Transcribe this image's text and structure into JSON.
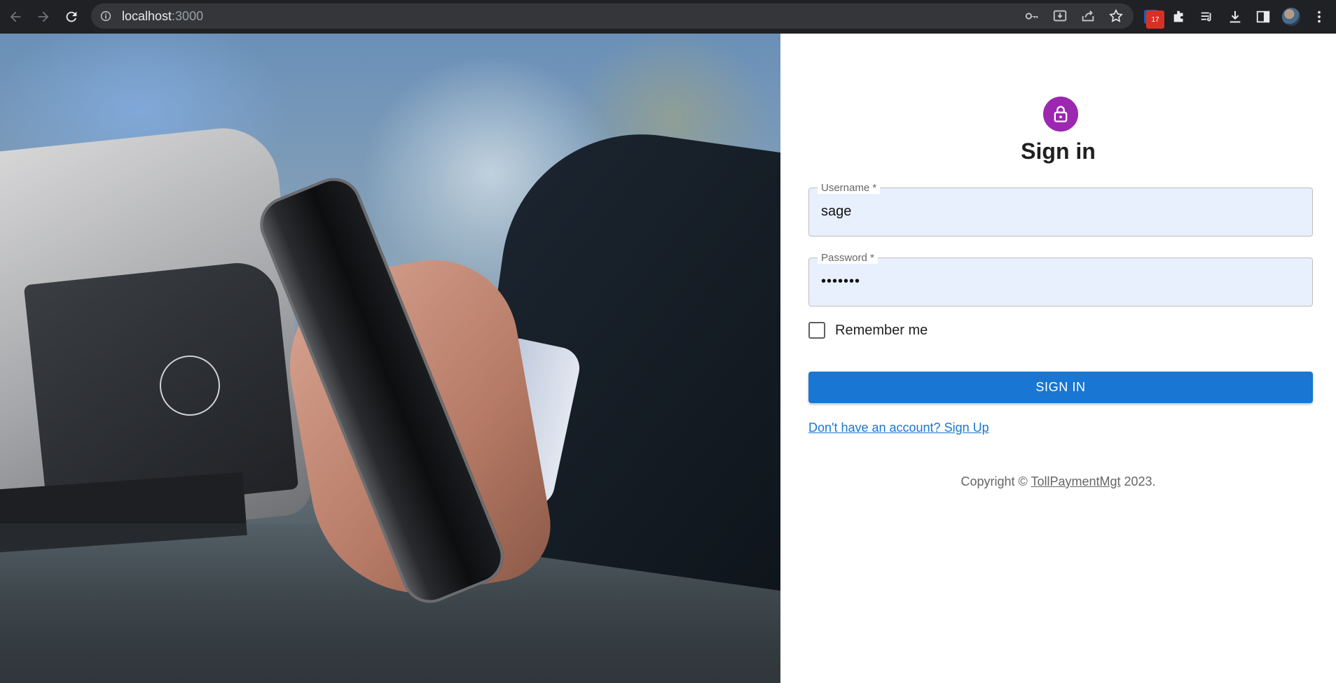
{
  "browser": {
    "url_host": "localhost",
    "url_port": ":3000",
    "extension_badge_count": "17",
    "linkedin_icon_text": "in"
  },
  "signin": {
    "title": "Sign in",
    "username_label": "Username *",
    "username_value": "sage",
    "password_label": "Password *",
    "password_value": "•••••••",
    "remember_label": "Remember me",
    "remember_checked": false,
    "button_label": "SIGN IN",
    "signup_link": "Don't have an account? Sign Up",
    "copyright_prefix": "Copyright © ",
    "copyright_link": "TollPaymentMgt",
    "copyright_suffix": " 2023.",
    "avatar_color": "#9c27b0",
    "button_color": "#1976d2",
    "field_bg": "#e8f0fe"
  }
}
